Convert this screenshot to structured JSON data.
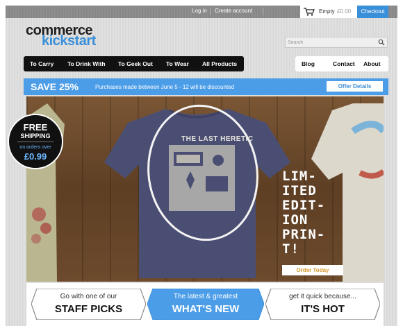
{
  "topbar": {
    "login": "Log in",
    "create_account": "Create account",
    "cart_status": "Empty",
    "cart_total": "£0.00",
    "checkout": "Checkout"
  },
  "logo": {
    "line1": "commerce",
    "line2": "kickstart"
  },
  "search": {
    "placeholder": "Search"
  },
  "nav": {
    "items": [
      "To Carry",
      "To Drink With",
      "To Geek Out",
      "To Wear",
      "All Products"
    ],
    "side_items": [
      "Blog",
      "Contact",
      "About"
    ]
  },
  "promo": {
    "headline": "SAVE 25%",
    "text": "Purchases made between June 5 - 12 will be discounted",
    "button": "Offer Details"
  },
  "hero": {
    "shirt_print": "THE LAST HERETIC",
    "shipping": {
      "free": "FREE",
      "label": "SHIPPING",
      "orders_over": "on orders over",
      "price": "£0.99"
    },
    "limited_lines": [
      "LIM-",
      "ITED",
      "EDIT-",
      "ION",
      "PRIN-",
      "T!"
    ],
    "order_button": "Order Today"
  },
  "ribbons": [
    {
      "small": "Go with one of our",
      "big": "STAFF PICKS",
      "active": false
    },
    {
      "small": "The latest & greatest",
      "big": "WHAT'S NEW",
      "active": true
    },
    {
      "small": "get it quick because...",
      "big": "IT'S HOT",
      "active": false
    }
  ],
  "colors": {
    "accent": "#3a8fd9",
    "promo": "#4c9de8",
    "nav_bg": "#111111",
    "order": "#d39a2e"
  }
}
